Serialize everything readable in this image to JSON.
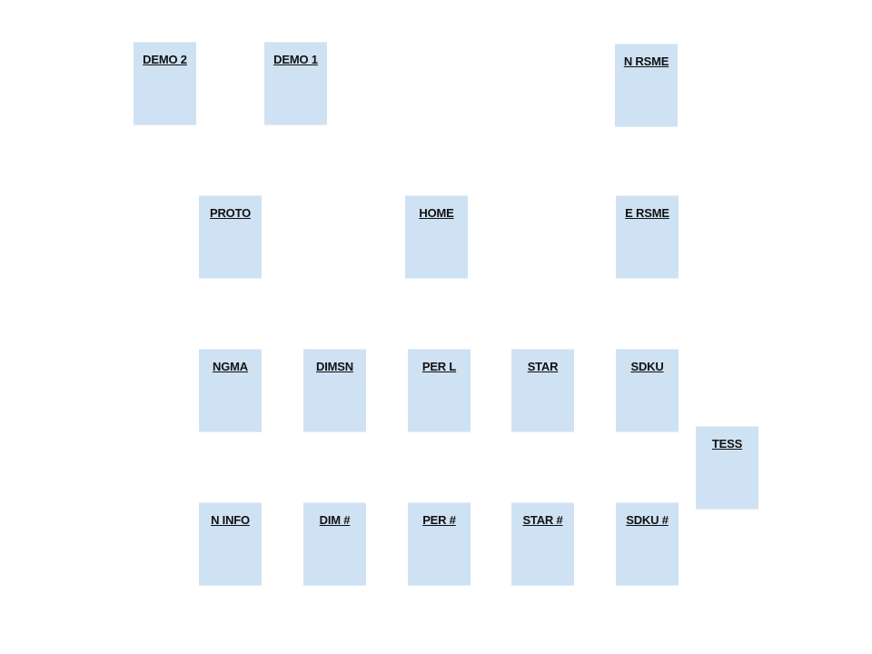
{
  "tiles": {
    "demo2": "DEMO 2",
    "demo1": "DEMO 1",
    "n_rsme": "N RSME",
    "proto": "PROTO",
    "home": "HOME",
    "e_rsme": "E RSME",
    "ngma": "NGMA",
    "dimsn": "DIMSN",
    "per_l": "PER L",
    "star": "STAR",
    "sdku": "SDKU",
    "tess": "TESS",
    "n_info": "N INFO",
    "dim_hash": "DIM #",
    "per_hash": "PER #",
    "star_hash": "STAR #",
    "sdku_hash": "SDKU #"
  },
  "colors": {
    "tile_fill": "#cfe2f3",
    "label_text": "#111111",
    "background": "#ffffff"
  }
}
